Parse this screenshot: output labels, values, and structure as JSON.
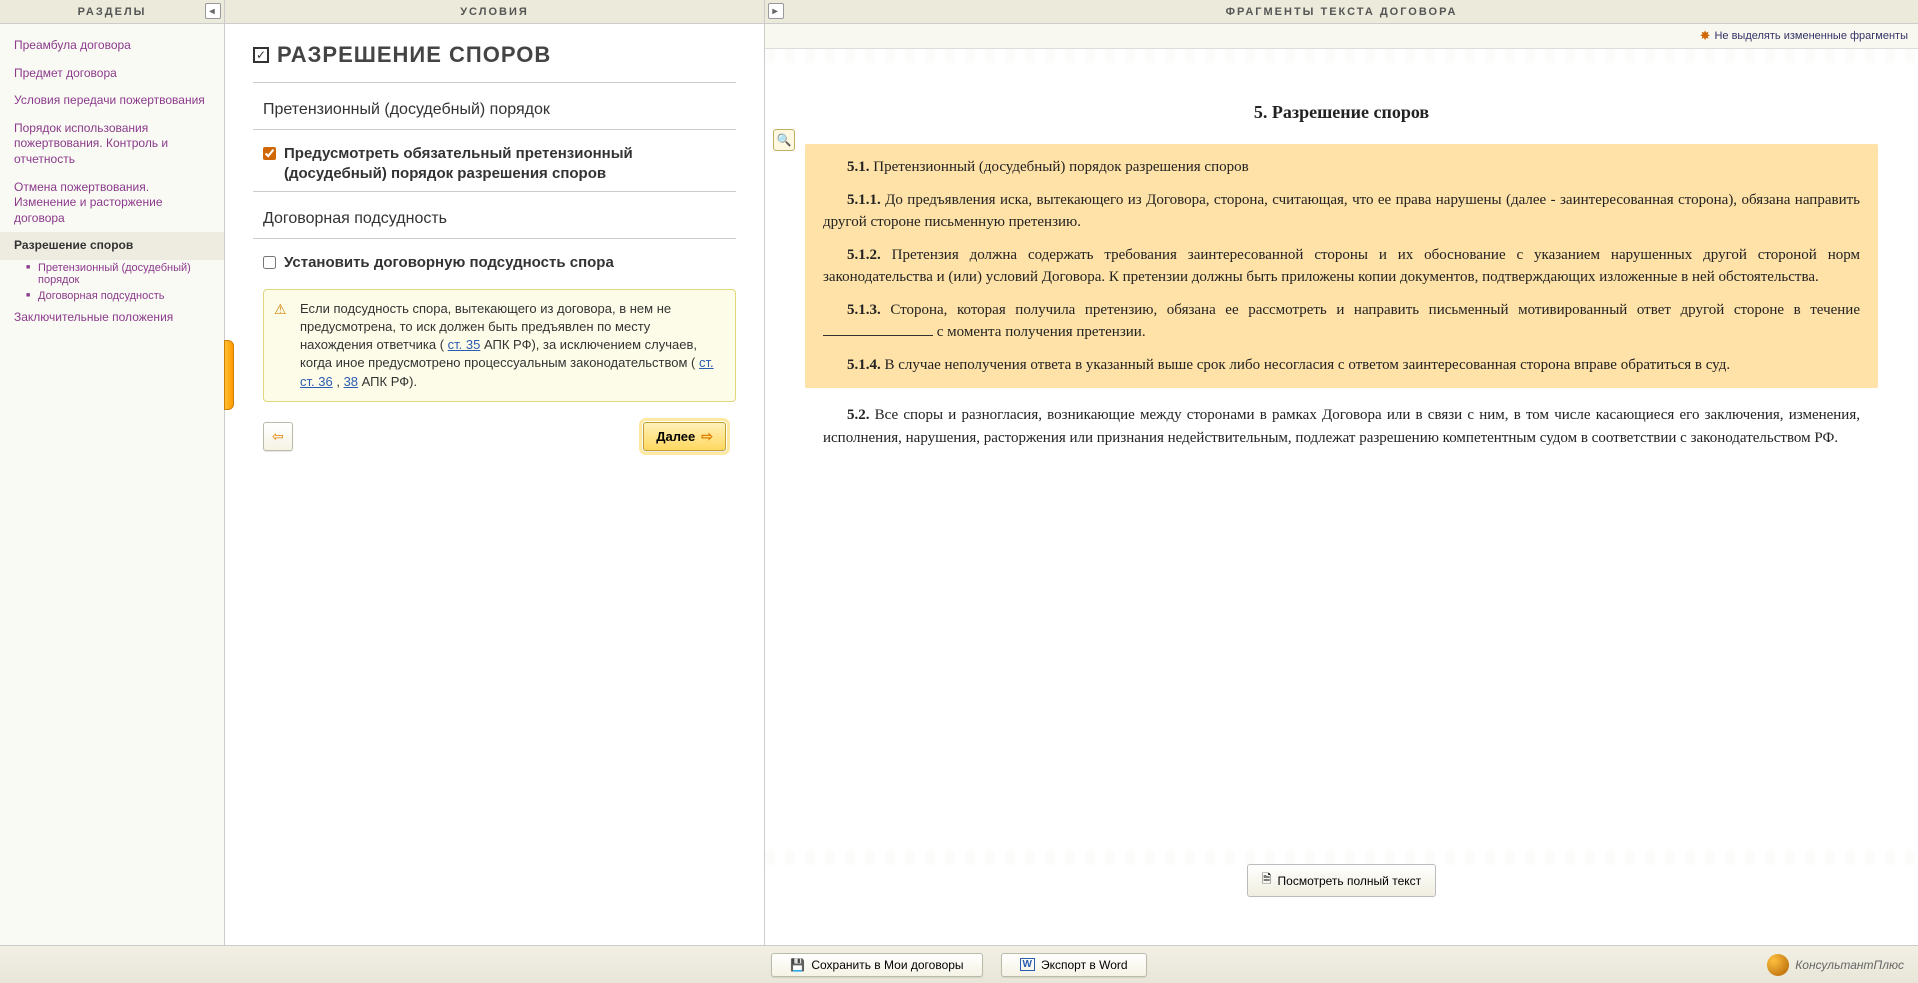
{
  "headers": {
    "sections": "РАЗДЕЛЫ",
    "conditions": "УСЛОВИЯ",
    "fragments": "ФРАГМЕНТЫ ТЕКСТА ДОГОВОРА"
  },
  "sidebar": {
    "items": [
      {
        "label": "Преамбула договора"
      },
      {
        "label": "Предмет договора"
      },
      {
        "label": "Условия  передачи пожертвования"
      },
      {
        "label": "Порядок использования пожертвования. Контроль и отчетность"
      },
      {
        "label": "Отмена пожертвования. Изменение и расторжение договора"
      },
      {
        "label": "Разрешение споров"
      },
      {
        "label": "Заключительные положения"
      }
    ],
    "subitems": [
      {
        "label": "Претензионный (досудебный) порядок"
      },
      {
        "label": "Договорная подсудность"
      }
    ]
  },
  "conditions": {
    "title": "РАЗРЕШЕНИЕ СПОРОВ",
    "sub1": {
      "title": "Претензионный (досудебный) порядок",
      "checkbox": "Предусмотреть обязательный претензионный (досудебный) порядок разрешения споров"
    },
    "sub2": {
      "title": "Договорная подсудность",
      "checkbox": "Установить договорную подсудность спора"
    },
    "info": {
      "t1": "Если подсудность спора, вытекающего из договора, в нем не предусмотрена, то иск должен быть предъявлен по месту нахождения ответчика ( ",
      "l1": "ст. 35",
      "t2": " АПК РФ), за исключением случаев, когда иное предусмотрено процессуальным законодательством ( ",
      "l2": "ст. ст. 36",
      "t3": ", ",
      "l3": "38",
      "t4": " АПК РФ)."
    },
    "next": "Далее"
  },
  "fragments": {
    "highlightLink": "Не выделять измененные фрагменты",
    "sectionNum": "5. ",
    "sectionTitle": "Разрешение споров",
    "p51_b": "5.1.",
    "p51": " Претензионный (досудебный) порядок разрешения споров",
    "p511_b": "5.1.1.",
    "p511": " До предъявления иска, вытекающего из Договора, сторона, считающая, что ее права нарушены (далее - заинтересованная сторона), обязана направить другой стороне письменную претензию.",
    "p512_b": "5.1.2.",
    "p512": " Претензия должна содержать требования заинтересованной стороны и их обоснование с указанием нарушенных другой стороной норм законодательства и (или) условий Договора. К претензии должны быть приложены копии документов, подтверждающих изложенные в ней обстоятельства.",
    "p513_b": "5.1.3.",
    "p513a": " Сторона, которая получила претензию, обязана ее рассмотреть и направить письменный мотивированный ответ другой стороне в течение ",
    "p513b": " с момента получения претензии.",
    "p514_b": "5.1.4.",
    "p514": " В случае неполучения ответа в указанный выше срок либо несогласия с ответом заинтересованная сторона вправе обратиться в суд.",
    "p52_b": "5.2.",
    "p52": " Все споры и разногласия, возникающие между сторонами в рамках Договора или в связи с ним, в том числе касающиеся его заключения, изменения, исполнения, нарушения, расторжения или признания недействительным, подлежат разрешению компетентным судом в соответствии с законодательством РФ.",
    "viewFull": "Посмотреть полный текст"
  },
  "footer": {
    "save": "Сохранить в Мои договоры",
    "export": "Экспорт в Word",
    "brand": "КонсультантПлюс"
  }
}
